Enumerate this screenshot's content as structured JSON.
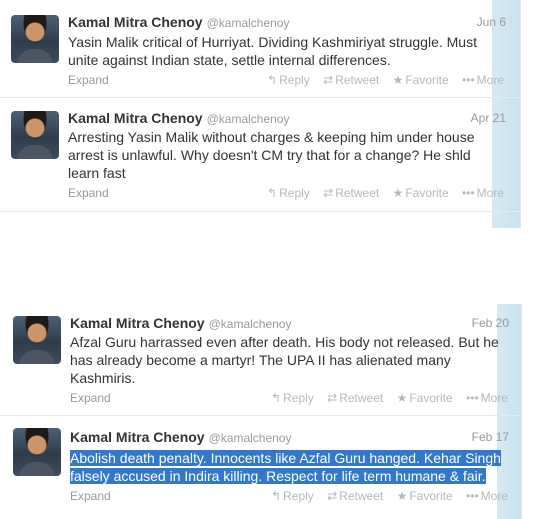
{
  "tweets": [
    {
      "name": "Kamal Mitra Chenoy",
      "handle": "@kamalchenoy",
      "date": "Jun 6",
      "lines": [
        "Yasin Malik critical of Hurriyat. Dividing Kashmiriyat struggle. Must",
        "unite against Indian state, settle internal differences."
      ],
      "expand": "Expand"
    },
    {
      "name": "Kamal Mitra Chenoy",
      "handle": "@kamalchenoy",
      "date": "Apr 21",
      "lines": [
        "Arresting Yasin Malik without charges & keeping him under house",
        "arrest is unlawful. Why doesn't CM try that for a change? He shld",
        "learn fast"
      ],
      "expand": "Expand"
    },
    {
      "name": "Kamal Mitra Chenoy",
      "handle": "@kamalchenoy",
      "date": "Feb 20",
      "lines": [
        "Afzal Guru harrassed even after death. His body not released. But he",
        "has already become a martyr! The UPA II has alienated many",
        "Kashmiris."
      ],
      "expand": "Expand"
    },
    {
      "name": "Kamal Mitra Chenoy",
      "handle": "@kamalchenoy",
      "date": "Feb 17",
      "lines": [
        "Abolish death penalty. Innocents like Azfal Guru hanged. Kehar Singh",
        "falsely accused in Indira killing. Respect for life term humane & fair."
      ],
      "expand": "Expand"
    }
  ],
  "actions": {
    "reply": "Reply",
    "retweet": "Retweet",
    "favorite": "Favorite",
    "more": "More"
  },
  "icons": {
    "reply": "reply-arrow-icon",
    "retweet": "retweet-icon",
    "favorite": "star-icon",
    "more": "dots-icon"
  },
  "colors": {
    "highlight": "#3478c9",
    "sidebar": "#c8e2ef"
  }
}
